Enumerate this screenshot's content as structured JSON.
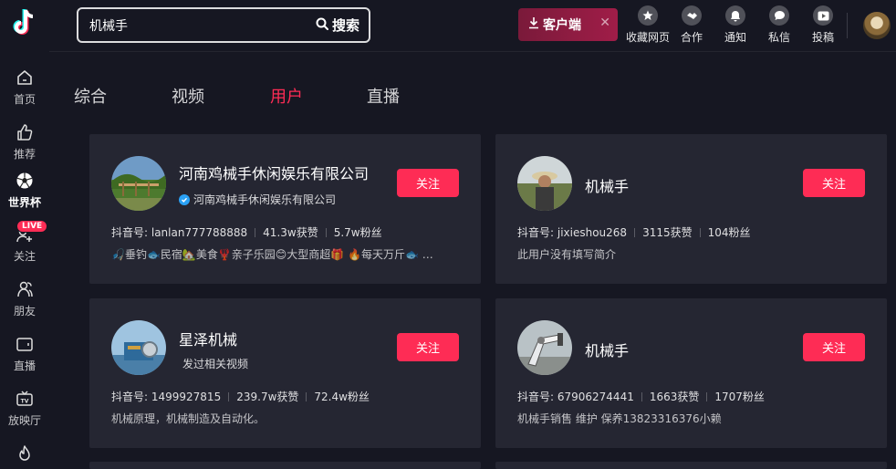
{
  "sidebar": {
    "items": [
      {
        "label": "首页",
        "icon": "home-icon"
      },
      {
        "label": "推荐",
        "icon": "thumbs-up-icon"
      },
      {
        "label": "世界杯",
        "icon": "soccer-ball-icon"
      },
      {
        "label": "关注",
        "icon": "add-user-icon",
        "badge": "LIVE"
      },
      {
        "label": "朋友",
        "icon": "friends-icon"
      },
      {
        "label": "直播",
        "icon": "live-tv-icon"
      },
      {
        "label": "放映厅",
        "icon": "tv-icon"
      },
      {
        "label": "",
        "icon": "fire-icon"
      }
    ]
  },
  "header": {
    "search_value": "机械手",
    "search_button": "搜索",
    "client_button": "客户端",
    "actions": [
      {
        "label": "收藏网页",
        "icon": "star-icon"
      },
      {
        "label": "合作",
        "icon": "handshake-icon"
      },
      {
        "label": "通知",
        "icon": "bell-icon"
      },
      {
        "label": "私信",
        "icon": "message-icon"
      },
      {
        "label": "投稿",
        "icon": "upload-video-icon"
      }
    ]
  },
  "tabs": [
    {
      "label": "综合"
    },
    {
      "label": "视频"
    },
    {
      "label": "用户",
      "active": true
    },
    {
      "label": "直播"
    }
  ],
  "results": [
    {
      "name": "河南鸡械手休闲娱乐有限公司",
      "subtitle": "河南鸡械手休闲娱乐有限公司",
      "verified": true,
      "follow": "关注",
      "douyin_id": "抖音号: lanlan777788888",
      "likes": "41.3w获赞",
      "fans": "5.7w粉丝",
      "bio": "🎣垂钓🐟民宿🏡美食🦞亲子乐园😊大型商超🎁 🔥每天万斤🐟 …"
    },
    {
      "name": "机械手",
      "subtitle": "",
      "verified": false,
      "follow": "关注",
      "douyin_id": "抖音号: jixieshou268",
      "likes": "3115获赞",
      "fans": "104粉丝",
      "bio": "此用户没有填写简介"
    },
    {
      "name": "星泽机械",
      "subtitle": "发过相关视频",
      "verified": false,
      "follow": "关注",
      "douyin_id": "抖音号: 1499927815",
      "likes": "239.7w获赞",
      "fans": "72.4w粉丝",
      "bio": "机械原理，机械制造及自动化。"
    },
    {
      "name": "机械手",
      "subtitle": "",
      "verified": false,
      "follow": "关注",
      "douyin_id": "抖音号: 67906274441",
      "likes": "1663获赞",
      "fans": "1707粉丝",
      "bio": "机械手销售 维护 保养13823316376小赖"
    }
  ],
  "colors": {
    "background": "#161722",
    "card": "#252632",
    "accent": "#fe2c55",
    "verified": "#2aa1f5"
  }
}
